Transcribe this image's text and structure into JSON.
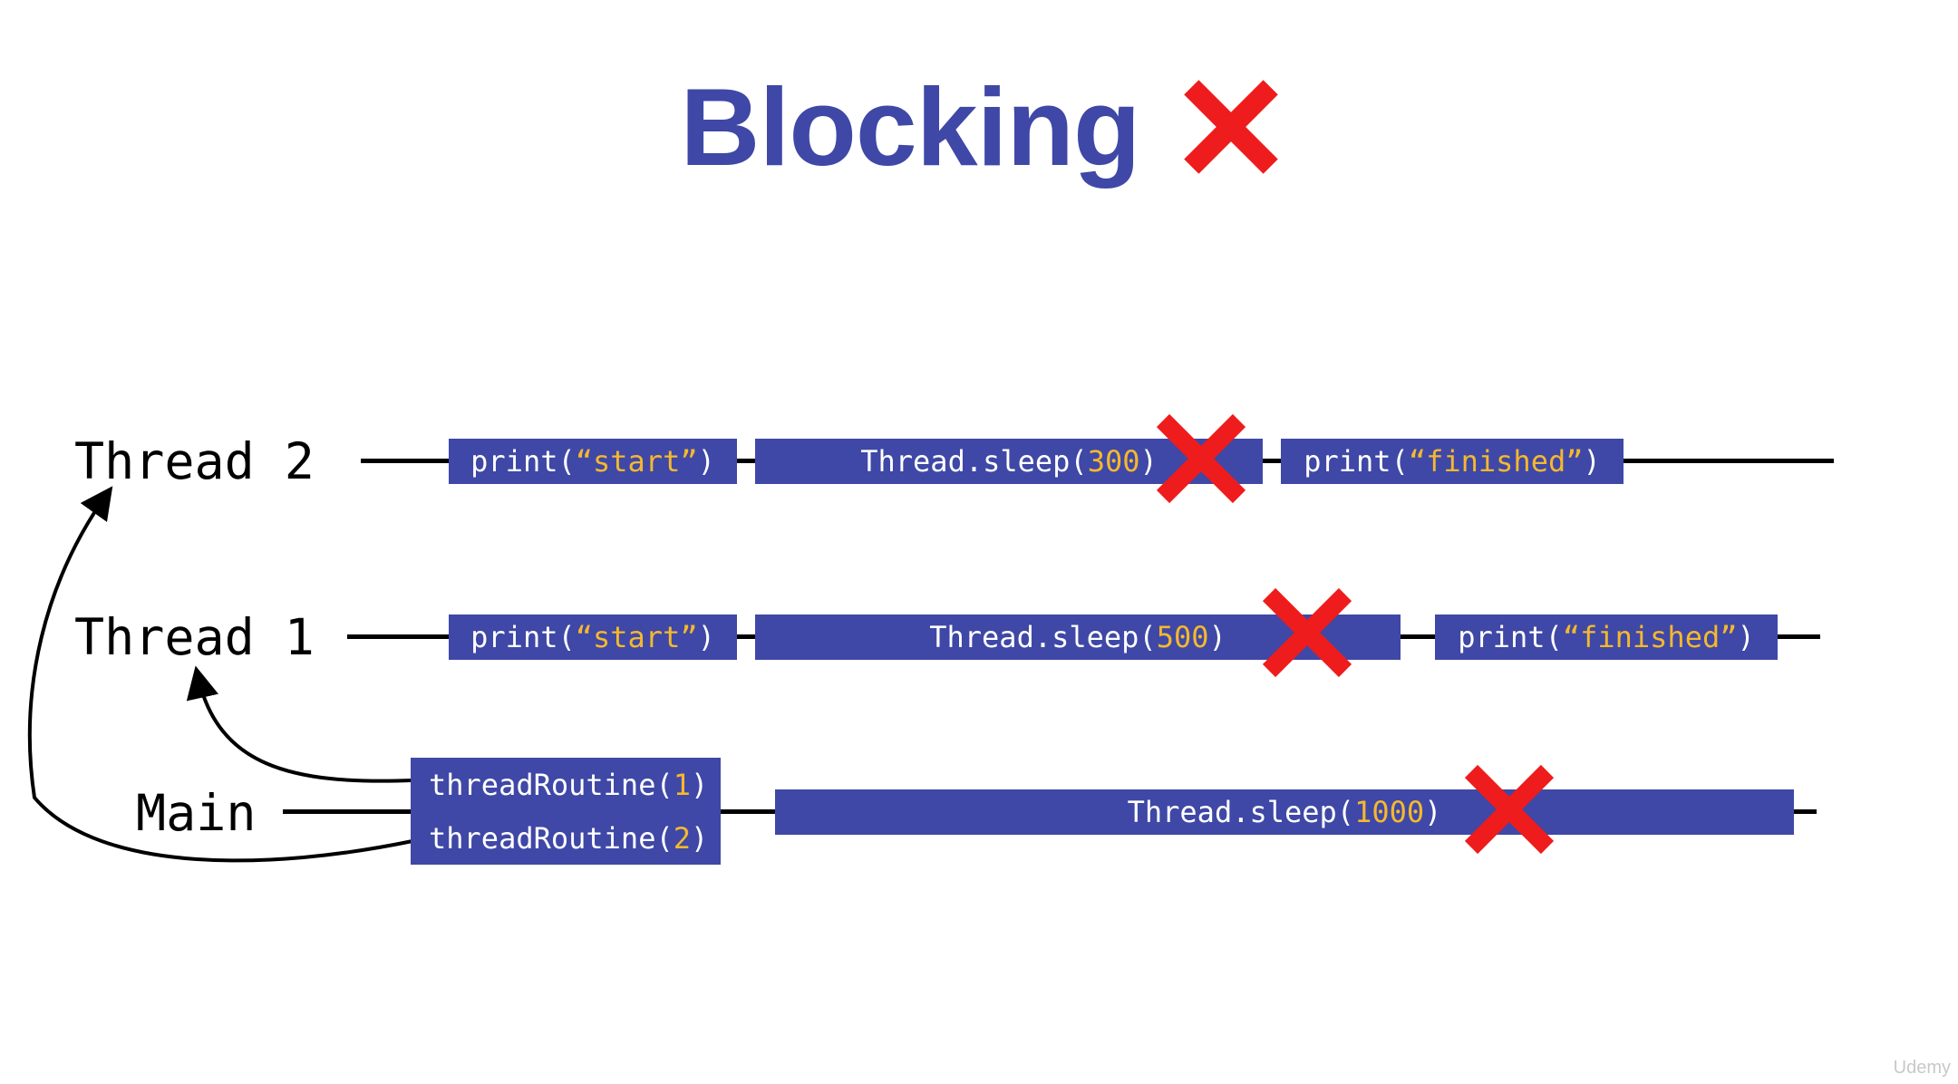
{
  "title": "Blocking",
  "colors": {
    "accent": "#3f48a6",
    "argument": "#f5b82e",
    "cross": "#ee1c1c"
  },
  "threads": {
    "thread2": {
      "label": "Thread 2",
      "blocks": [
        {
          "prefix": "print(",
          "arg": "“start”",
          "suffix": ")"
        },
        {
          "prefix": "Thread.sleep(",
          "arg": "300",
          "suffix": ")"
        },
        {
          "prefix": "print(",
          "arg": "“finished”",
          "suffix": ")"
        }
      ]
    },
    "thread1": {
      "label": "Thread 1",
      "blocks": [
        {
          "prefix": "print(",
          "arg": "“start”",
          "suffix": ")"
        },
        {
          "prefix": "Thread.sleep(",
          "arg": "500",
          "suffix": ")"
        },
        {
          "prefix": "print(",
          "arg": "“finished”",
          "suffix": ")"
        }
      ]
    },
    "main": {
      "label": "Main",
      "calls": [
        {
          "prefix": "threadRoutine(",
          "arg": "1",
          "suffix": ")"
        },
        {
          "prefix": "threadRoutine(",
          "arg": "2",
          "suffix": ")"
        }
      ],
      "sleep": {
        "prefix": "Thread.sleep(",
        "arg": "1000",
        "suffix": ")"
      }
    }
  },
  "watermark": "Udemy"
}
